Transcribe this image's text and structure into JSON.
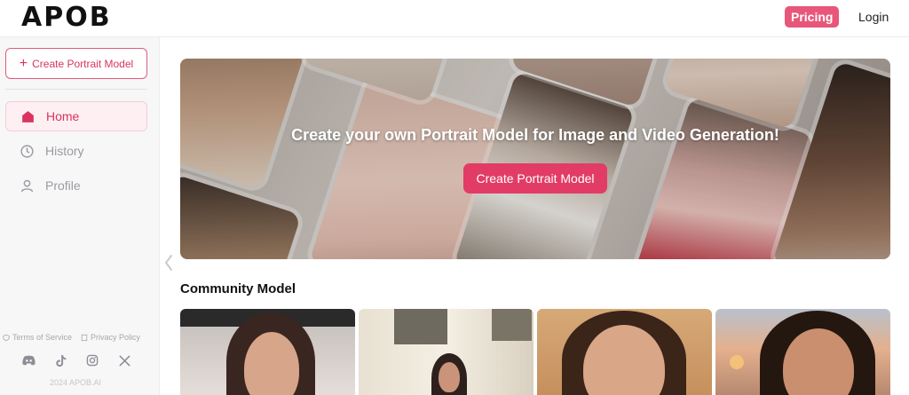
{
  "header": {
    "logo_text": "APOB",
    "pricing_label": "Pricing",
    "login_label": "Login"
  },
  "sidebar": {
    "create_label": "Create Portrait Model",
    "items": [
      {
        "label": "Home",
        "icon": "home-icon",
        "active": true
      },
      {
        "label": "History",
        "icon": "clock-icon",
        "active": false
      },
      {
        "label": "Profile",
        "icon": "user-icon",
        "active": false
      }
    ],
    "footer": {
      "terms_label": "Terms of Service",
      "privacy_label": "Privacy Policy",
      "socials": [
        "discord-icon",
        "tiktok-icon",
        "instagram-icon",
        "x-icon"
      ],
      "copyright": "2024 APOB.AI"
    }
  },
  "hero": {
    "title": "Create your own Portrait Model for Image and Video Generation!",
    "button_label": "Create Portrait Model"
  },
  "community": {
    "title": "Community Model",
    "cards": [
      {
        "name": "community-card-1"
      },
      {
        "name": "community-card-2"
      },
      {
        "name": "community-card-3"
      },
      {
        "name": "community-card-4"
      }
    ]
  },
  "colors": {
    "accent": "#e23c66",
    "accent_light": "#fdeff2",
    "sidebar_bg": "#f7f7f8"
  }
}
